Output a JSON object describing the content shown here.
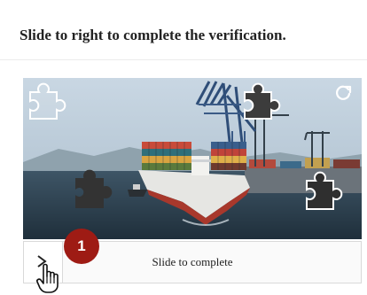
{
  "header": {
    "title": "Slide to right to complete the verification."
  },
  "captcha": {
    "image_icon": "container-ship-photo",
    "refresh_icon": "refresh-icon",
    "puzzle_icon": "puzzle-piece-icon"
  },
  "slider": {
    "label": "Slide to complete",
    "handle_icon": "chevron-right-icon"
  },
  "annotation": {
    "step_number": "1",
    "badge_color": "#9e1b14",
    "cursor_icon": "hand-pointer-icon"
  }
}
